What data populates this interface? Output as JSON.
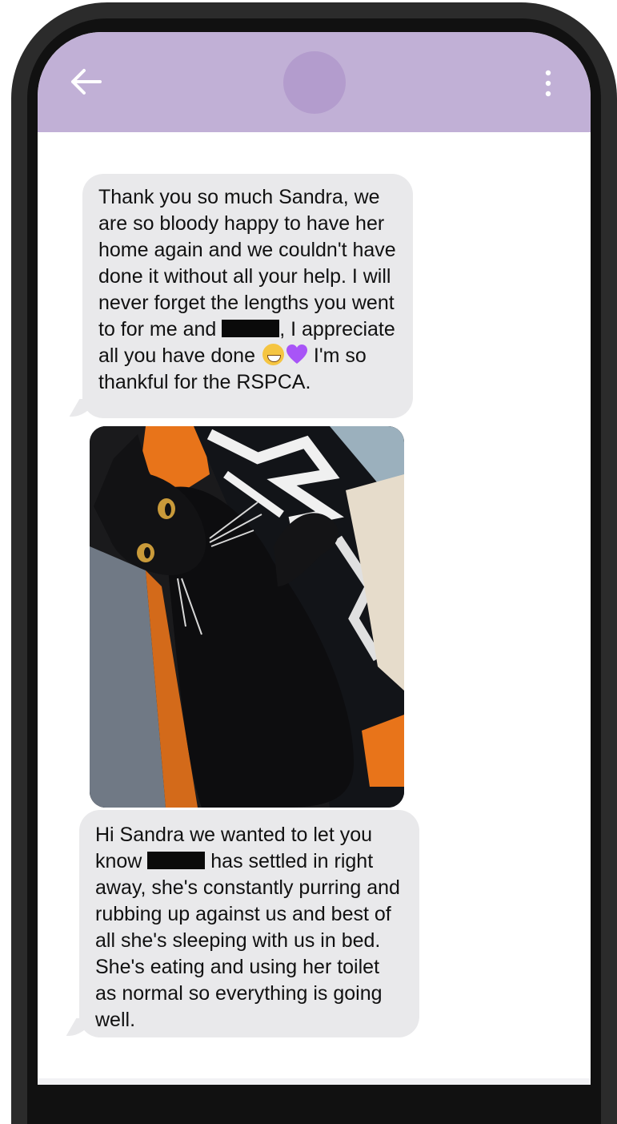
{
  "messages": [
    {
      "text_before": "Thank you so much Sandra, we are so bloody happy to have her home again and we couldn't have done it without all your help.  I will never forget the lengths you went to for me and ",
      "text_middle": ", I appreciate all you have done ",
      "text_after": " I'm so thankful for the RSPCA."
    },
    {
      "text_before": "Hi Sandra we wanted to let you know ",
      "text_after": " has settled in right away, she's constantly purring and rubbing up against us and best of all she's sleeping with us in bed. She's eating and using her toilet as normal so everything is going well."
    }
  ],
  "icons": {
    "back": "arrow-left-icon",
    "menu": "kebab-menu-icon",
    "emoji_1": "grinning-face-emoji",
    "emoji_2": "purple-heart-emoji"
  },
  "colors": {
    "header_bg": "#c1b0d6",
    "avatar_bg": "#b39ccd",
    "bubble_bg": "#e9e9eb",
    "heart": "#a855f7",
    "phone_frame": "#2b2b2b"
  }
}
